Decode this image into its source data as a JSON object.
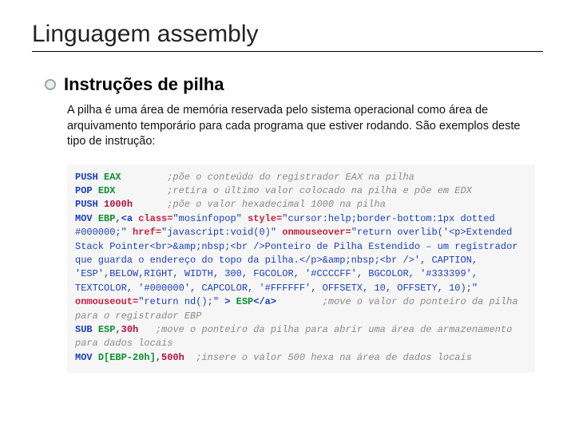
{
  "title": "Linguagem assembly",
  "subhead": "Instruções de pilha",
  "body": "A pilha é uma área de memória reservada pelo sistema operacional como área de arquivamento temporário para cada programa que estiver rodando. São exemplos deste tipo de instrução:",
  "code": {
    "l1": {
      "kw": "PUSH",
      "reg": "EAX",
      "cmt": ";põe o conteúdo do registrador EAX na pilha"
    },
    "l2": {
      "kw": "POP",
      "reg": "EDX",
      "cmt": ";retira o último valor colocado na pilha e põe em EDX"
    },
    "l3": {
      "kw": "PUSH",
      "num": "1000h",
      "cmt": ";põe o valor hexadecimal 1000 na pilha"
    },
    "l4": {
      "kw": "MOV",
      "reg": "EBP",
      "p0": ",",
      "open": "<a",
      "a1n": " class=",
      "a1v": "\"mosinfopop\"",
      "a2n": " style=",
      "a2v": "\"cursor:help;border-bottom:1px dotted #000000;\"",
      "a3n": " href=",
      "a3v": "\"javascript:void(0)\"",
      "a4n": " onmouseover=",
      "a4v": "\"return overlib('<p>Extended Stack Pointer<br>&amp;nbsp;<br />Ponteiro de Pilha Estendido – um registrador que guarda o endereço do topo da pilha.</p>&amp;nbsp;<br />', CAPTION, 'ESP',BELOW,RIGHT, WIDTH, 300, FGCOLOR, '#CCCCFF', BGCOLOR, '#333399', TEXTCOLOR, '#000000', CAPCOLOR, '#FFFFFF', OFFSETX, 10, OFFSETY, 10);\"",
      "a5n": " onmouseout=",
      "a5v": "\"return nd();\"",
      "close1": " >",
      "esp": " ESP",
      "close2": "</a>",
      "cmt": "        ;move o valor do ponteiro da pilha para o registrador EBP"
    },
    "l5": {
      "kw": "SUB",
      "reg": "ESP",
      "p0": ",",
      "num": "30h",
      "cmt": "   ;move o ponteiro da pilha para abrir uma área de armazenamento para dados locais"
    },
    "l6": {
      "kw": "MOV",
      "reg": "D[EBP-20h]",
      "p0": ",",
      "num": "500h",
      "cmt": "  ;insere o valor 500 hexa na área de dados locais"
    }
  }
}
